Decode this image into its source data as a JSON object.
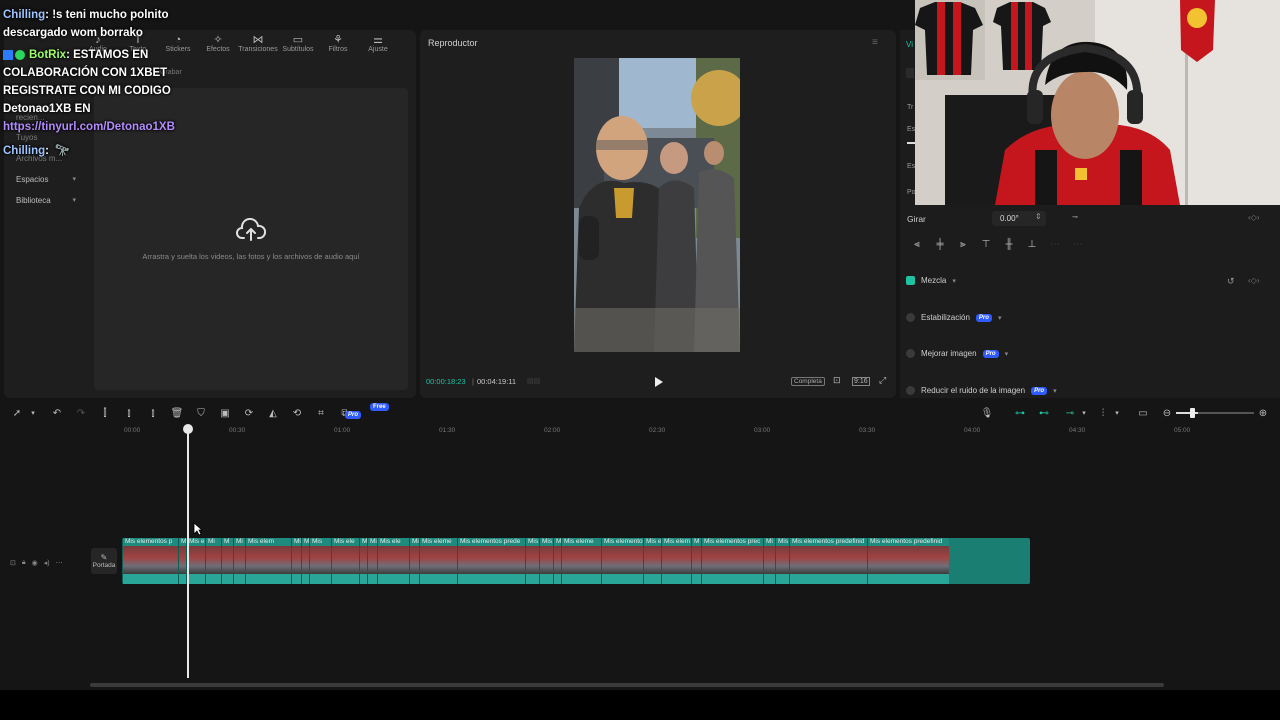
{
  "media": {
    "tabs": [
      {
        "label": "Audio",
        "icon": "music-icon"
      },
      {
        "label": "Texto",
        "icon": "text-icon"
      },
      {
        "label": "Stickers",
        "icon": "sticker-icon"
      },
      {
        "label": "Efectos",
        "icon": "effects-icon"
      },
      {
        "label": "Transiciones",
        "icon": "transitions-icon"
      },
      {
        "label": "Subtítulos",
        "icon": "subtitles-icon"
      },
      {
        "label": "Filtros",
        "icon": "filters-icon"
      },
      {
        "label": "Ajuste",
        "icon": "adjust-icon"
      }
    ],
    "sidebar": [
      {
        "label": "Proyectos recien..."
      },
      {
        "label": "Tuyos"
      },
      {
        "label": "Archivos m..."
      },
      {
        "label": "Espacios"
      },
      {
        "label": "Biblioteca"
      }
    ],
    "record_label": "Grabar",
    "dropzone_text": "Arrastra y suelta los videos, las fotos y los archivos de audio aquí"
  },
  "player": {
    "title": "Reproductor",
    "time_current": "00:00:18:23",
    "time_total": "00:04:19:11",
    "quality": "Completa"
  },
  "props": {
    "rotate_label": "Girar",
    "rotate_value": "0.00°",
    "rows": [
      {
        "label": "Mezcla",
        "checked": true,
        "pro": false
      },
      {
        "label": "Estabilización",
        "checked": false,
        "pro": true
      },
      {
        "label": "Mejorar imagen",
        "checked": false,
        "pro": true
      },
      {
        "label": "Reducir el ruido de la imagen",
        "checked": false,
        "pro": true
      }
    ],
    "pro_label": "Pro"
  },
  "timeline": {
    "ticks": [
      "00:00",
      "00:30",
      "01:00",
      "01:30",
      "02:00",
      "02:30",
      "03:00",
      "03:30",
      "04:00",
      "04:30",
      "05:00"
    ],
    "cover_label": "Portada",
    "clips": [
      {
        "label": "Mis elementos p"
      },
      {
        "label": "M"
      },
      {
        "label": "Mis e"
      },
      {
        "label": "Mi"
      },
      {
        "label": "M"
      },
      {
        "label": "Mi"
      },
      {
        "label": "Mis elem"
      },
      {
        "label": "Mi"
      },
      {
        "label": "Mi"
      },
      {
        "label": "Mis"
      },
      {
        "label": "Mis ele"
      },
      {
        "label": "M"
      },
      {
        "label": "Mi"
      },
      {
        "label": "Mis ele"
      },
      {
        "label": "Mi"
      },
      {
        "label": "Mis eleme"
      },
      {
        "label": "Mis elementos prede"
      },
      {
        "label": "Mis"
      },
      {
        "label": "Mis"
      },
      {
        "label": "M"
      },
      {
        "label": "Mis eleme"
      },
      {
        "label": "Mis elemento"
      },
      {
        "label": "Mis e"
      },
      {
        "label": "Mis elem"
      },
      {
        "label": "M"
      },
      {
        "label": "Mis elementos prec"
      },
      {
        "label": "Mi"
      },
      {
        "label": "Mis"
      },
      {
        "label": "Mis elementos predefinid"
      },
      {
        "label": "Mis elementos predefinid"
      }
    ]
  },
  "chat": {
    "line1_user": "Chilling",
    "line1_text": ": !s teni mucho polnito",
    "line2_text": "descargado wom borrako",
    "line3_user": "BotRix",
    "line3_text": ": ESTAMOS EN",
    "line4_text": "COLABORACIÓN CON 1XBET",
    "line5_text": "REGISTRATE CON MI CODIGO",
    "line6_text": "Detonao1XB EN",
    "line7_link": "https://tinyurl.com/Detonao1XB",
    "line8_user": "Chilling",
    "line8_text": ":"
  },
  "colors": {
    "accent": "#1ec3a3",
    "track": "#1a7e73",
    "pro_badge": "#2f5bff"
  }
}
